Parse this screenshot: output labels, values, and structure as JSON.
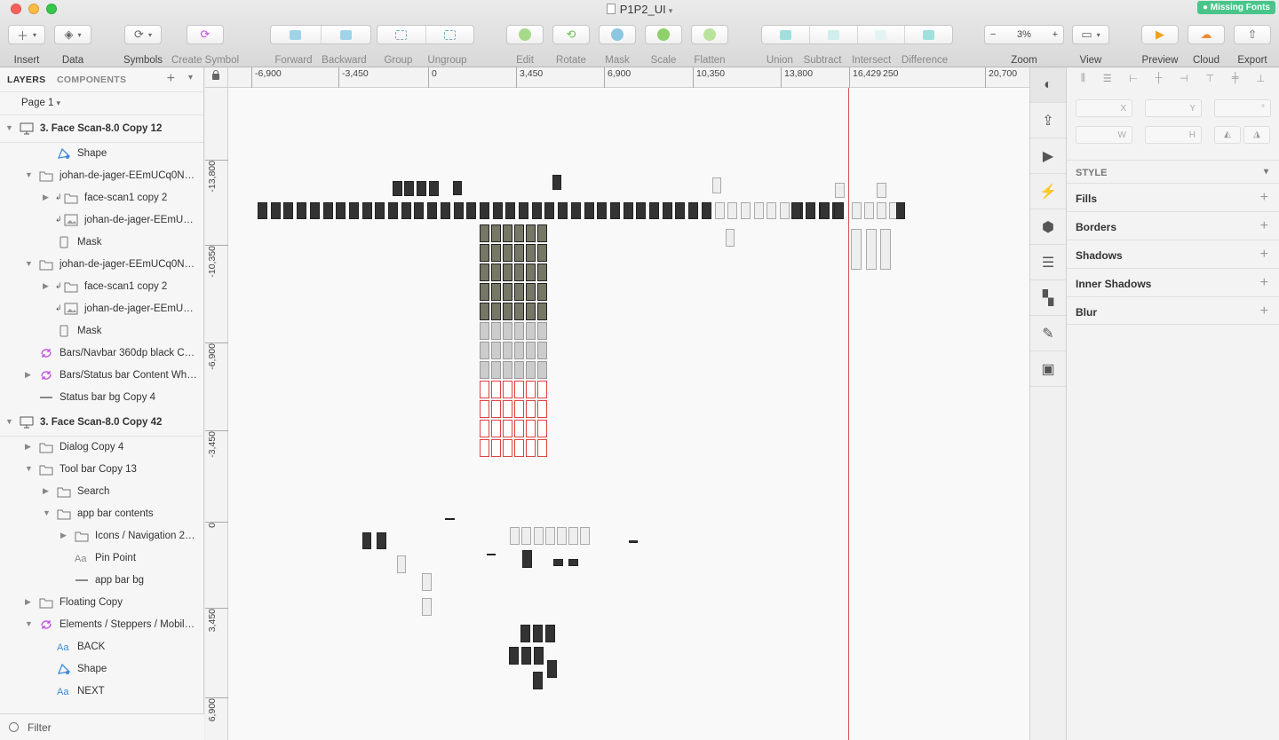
{
  "window": {
    "title": "P1P2_UI",
    "missing_fonts": "Missing Fonts"
  },
  "colors": {
    "close": "#fc605c",
    "minimize": "#fdbc40",
    "zoom": "#34c749",
    "accent_purple": "#c14de0",
    "guide": "#d9534f",
    "missing_fonts": "#49c58a"
  },
  "toolbar": {
    "insert": "Insert",
    "data": "Data",
    "symbols": "Symbols",
    "create_symbol": "Create Symbol",
    "forward": "Forward",
    "backward": "Backward",
    "group": "Group",
    "ungroup": "Ungroup",
    "edit": "Edit",
    "rotate": "Rotate",
    "mask": "Mask",
    "scale": "Scale",
    "flatten": "Flatten",
    "union": "Union",
    "subtract": "Subtract",
    "intersect": "Intersect",
    "difference": "Difference",
    "zoom": "Zoom",
    "zoom_value": "3%",
    "zoom_minus": "−",
    "zoom_plus": "+",
    "view": "View",
    "preview": "Preview",
    "cloud": "Cloud",
    "export": "Export"
  },
  "sidebar": {
    "tab_layers": "LAYERS",
    "tab_components": "COMPONENTS",
    "page": "Page 1",
    "filter": "Filter",
    "layers": [
      {
        "name": "3. Face Scan-8.0 Copy 12",
        "indent": 0,
        "icon": "artboard-icon",
        "disclosure": "open",
        "artboard": true
      },
      {
        "name": "Shape",
        "indent": 2,
        "icon": "shape-icon",
        "disclosure": "none"
      },
      {
        "name": "johan-de-jager-EEmUCq0NN...",
        "indent": 1,
        "icon": "folder-icon",
        "disclosure": "open"
      },
      {
        "name": "face-scan1 copy 2",
        "indent": 2,
        "icon": "folder-icon",
        "disclosure": "closed",
        "masked": true
      },
      {
        "name": "johan-de-jager-EEmUCq...",
        "indent": 2,
        "icon": "image-icon",
        "disclosure": "none",
        "masked": true
      },
      {
        "name": "Mask",
        "indent": 2,
        "icon": "rectangle-icon",
        "disclosure": "none"
      },
      {
        "name": "johan-de-jager-EEmUCq0NN...",
        "indent": 1,
        "icon": "folder-icon",
        "disclosure": "open"
      },
      {
        "name": "face-scan1 copy 2",
        "indent": 2,
        "icon": "folder-icon",
        "disclosure": "closed",
        "masked": true
      },
      {
        "name": "johan-de-jager-EEmUCq...",
        "indent": 2,
        "icon": "image-icon",
        "disclosure": "none",
        "masked": true
      },
      {
        "name": "Mask",
        "indent": 2,
        "icon": "rectangle-icon",
        "disclosure": "none"
      },
      {
        "name": "Bars/Navbar 360dp black Co...",
        "indent": 1,
        "icon": "symbol-icon",
        "disclosure": "none"
      },
      {
        "name": "Bars/Status bar Content Whit...",
        "indent": 1,
        "icon": "symbol-icon",
        "disclosure": "closed"
      },
      {
        "name": "Status bar bg Copy 4",
        "indent": 1,
        "icon": "line-icon",
        "disclosure": "none"
      },
      {
        "name": "3. Face Scan-8.0 Copy 42",
        "indent": 0,
        "icon": "artboard-icon",
        "disclosure": "open",
        "artboard": true
      },
      {
        "name": "Dialog Copy 4",
        "indent": 1,
        "icon": "folder-icon",
        "disclosure": "closed"
      },
      {
        "name": "Tool bar Copy 13",
        "indent": 1,
        "icon": "folder-icon",
        "disclosure": "open"
      },
      {
        "name": "Search",
        "indent": 2,
        "icon": "folder-icon",
        "disclosure": "closed"
      },
      {
        "name": "app bar contents",
        "indent": 2,
        "icon": "folder-icon",
        "disclosure": "open"
      },
      {
        "name": "Icons / Navigation 24px /...",
        "indent": 3,
        "icon": "folder-icon",
        "disclosure": "closed"
      },
      {
        "name": "Pin Point",
        "indent": 3,
        "icon": "text-icon",
        "disclosure": "none"
      },
      {
        "name": "app bar bg",
        "indent": 3,
        "icon": "line-icon",
        "disclosure": "none"
      },
      {
        "name": "Floating Copy",
        "indent": 1,
        "icon": "folder-icon",
        "disclosure": "closed"
      },
      {
        "name": "Elements / Steppers / Mobile...",
        "indent": 1,
        "icon": "symbol-icon",
        "disclosure": "open"
      },
      {
        "name": "BACK",
        "indent": 2,
        "icon": "text-icon-blue",
        "disclosure": "none"
      },
      {
        "name": "Shape",
        "indent": 2,
        "icon": "shape-icon",
        "disclosure": "none"
      },
      {
        "name": "NEXT",
        "indent": 2,
        "icon": "text-icon-blue",
        "disclosure": "none"
      }
    ]
  },
  "ruler": {
    "h": [
      "-6,900",
      "-3,450",
      "0",
      "3,450",
      "6,900",
      "10,350",
      "13,800",
      "16,429",
      "250",
      "20,700"
    ],
    "v": [
      "-13,800",
      "-10,350",
      "-6,900",
      "-3,450",
      "0",
      "3,450",
      "6,900"
    ]
  },
  "inspector": {
    "x": "X",
    "y": "Y",
    "rot": "°",
    "w": "W",
    "h": "H",
    "style": "STYLE",
    "fills": "Fills",
    "borders": "Borders",
    "shadows": "Shadows",
    "inner_shadows": "Inner Shadows",
    "blur": "Blur"
  }
}
